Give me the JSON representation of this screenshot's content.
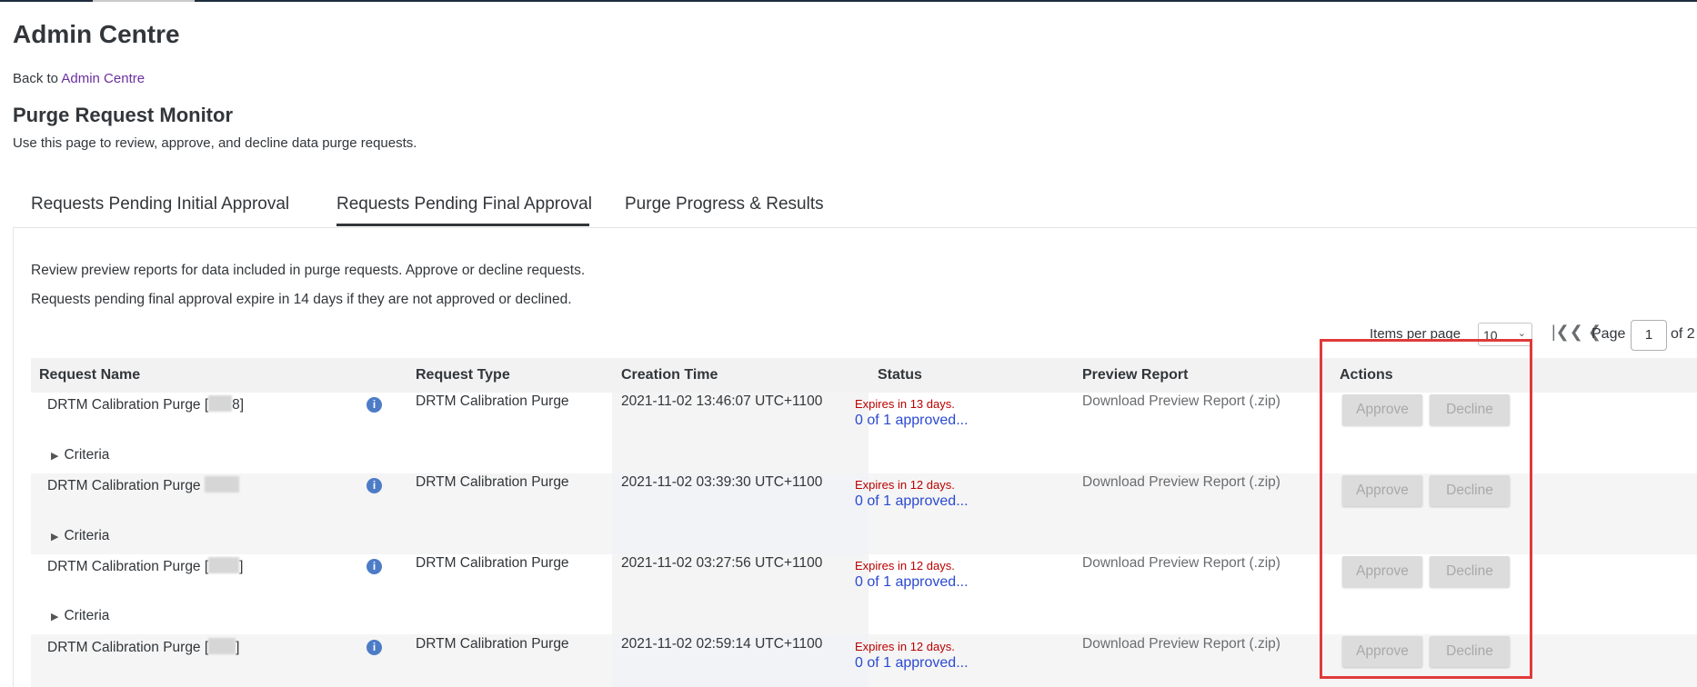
{
  "page": {
    "title": "Admin Centre",
    "back_prefix": "Back to",
    "back_link": "Admin Centre",
    "section_title": "Purge Request Monitor",
    "section_subtitle": "Use this page to review, approve, and decline data purge requests."
  },
  "tabs": [
    {
      "label": "Requests Pending Initial Approval"
    },
    {
      "label": "Requests Pending Final Approval"
    },
    {
      "label": "Purge Progress & Results"
    }
  ],
  "info_lines": [
    "Review preview reports for data included in purge requests. Approve or decline requests.",
    "Requests pending final approval expire in 14 days if they are not approved or declined."
  ],
  "pagination": {
    "items_per_page_label": "Items per page",
    "items_per_page": "10",
    "page_label": "Page",
    "page": "1",
    "of_label": "of 2"
  },
  "columns": [
    "Request Name",
    "Request Type",
    "Creation Time",
    "Status",
    "Preview Report",
    "Actions"
  ],
  "rows": [
    {
      "name": "DRTM Calibration Purge [",
      "name_suffix": "8]",
      "type": "DRTM Calibration Purge",
      "created": "2021-11-02 13:46:07 UTC+1100",
      "expires": "Expires in 13 days.",
      "approved": "0 of 1 approved...",
      "preview": "Download Preview Report (.zip)",
      "criteria": "Criteria",
      "approve": "Approve",
      "decline": "Decline"
    },
    {
      "name": "DRTM Calibration Purge",
      "name_suffix": "",
      "type": "DRTM Calibration Purge",
      "created": "2021-11-02 03:39:30 UTC+1100",
      "expires": "Expires in 12 days.",
      "approved": "0 of 1 approved...",
      "preview": "Download Preview Report (.zip)",
      "criteria": "Criteria",
      "approve": "Approve",
      "decline": "Decline"
    },
    {
      "name": "DRTM Calibration Purge [",
      "name_suffix": "]",
      "type": "DRTM Calibration Purge",
      "created": "2021-11-02 03:27:56 UTC+1100",
      "expires": "Expires in 12 days.",
      "approved": "0 of 1 approved...",
      "preview": "Download Preview Report (.zip)",
      "criteria": "Criteria",
      "approve": "Approve",
      "decline": "Decline"
    },
    {
      "name": "DRTM Calibration Purge [",
      "name_suffix": "]",
      "type": "DRTM Calibration Purge",
      "created": "2021-11-02 02:59:14 UTC+1100",
      "expires": "Expires in 12 days.",
      "approved": "0 of 1 approved...",
      "preview": "Download Preview Report (.zip)",
      "criteria": "Criteria",
      "approve": "Approve",
      "decline": "Decline"
    }
  ],
  "icons": {
    "info": "info-icon",
    "expand": "triangle-right-icon",
    "first_page": "double-chevron-left-icon",
    "prev_page": "chevron-left-icon",
    "dropdown": "chevron-down-icon"
  },
  "colors": {
    "link": "#6b2fa0",
    "status_link": "#2b4ad1",
    "expires": "#bb0000",
    "info_icon": "#4d7cc7",
    "highlight_box": "#e03a3a"
  }
}
